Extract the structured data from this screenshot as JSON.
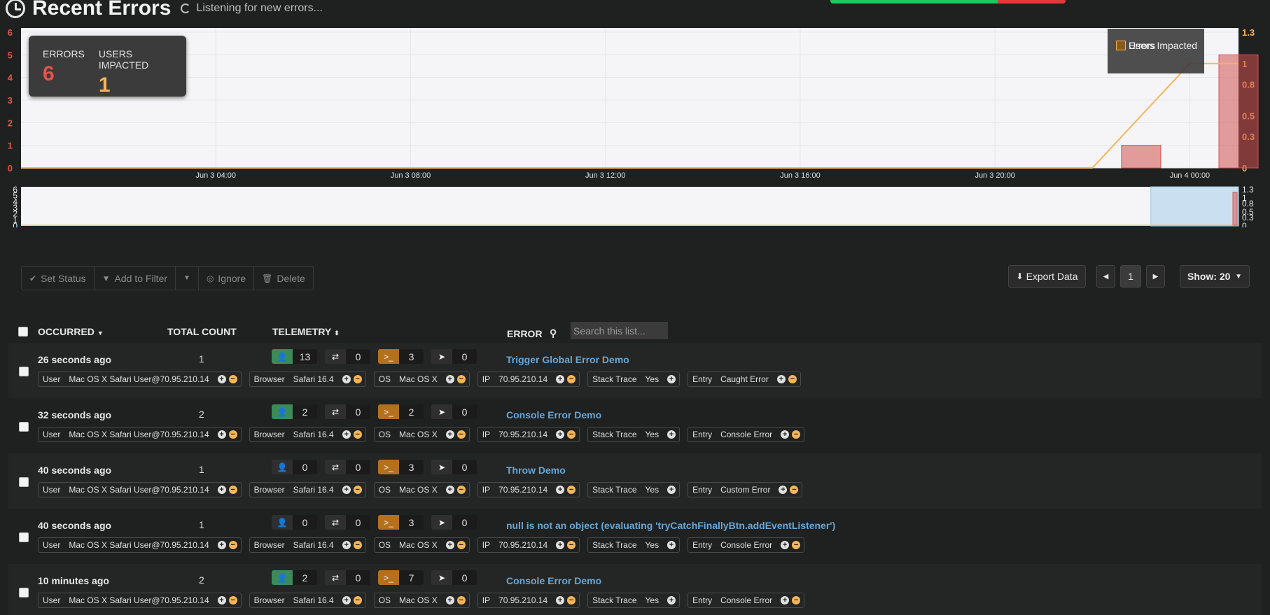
{
  "header": {
    "title": "Recent Errors",
    "status": "Listening for new errors..."
  },
  "stats": {
    "errors_label": "ERRORS",
    "errors_value": "6",
    "users_label": "USERS IMPACTED",
    "users_value": "1"
  },
  "chart_data": [
    {
      "type": "bar",
      "title": "",
      "x_tick_labels": [
        "Jun 3 04:00",
        "Jun 3 08:00",
        "Jun 3 12:00",
        "Jun 3 16:00",
        "Jun 3 20:00",
        "Jun 4 00:00"
      ],
      "y_left_ticks": [
        "0",
        "1",
        "2",
        "3",
        "4",
        "5",
        "6"
      ],
      "y_right_ticks": [
        "0",
        "0.3",
        "0.5",
        "0.8",
        "1",
        "1.3"
      ],
      "ylim_left": [
        0,
        6
      ],
      "ylim_right": [
        0,
        1.3
      ],
      "legend": [
        "Errors",
        "Users Impacted"
      ],
      "legend_position": "top-right",
      "grid": true,
      "series": [
        {
          "name": "Errors",
          "type": "bar",
          "axis": "left",
          "color": "#d9534f",
          "x": [
            "Jun 3 23:00",
            "Jun 4 01:00"
          ],
          "values": [
            1,
            5
          ]
        },
        {
          "name": "Users Impacted",
          "type": "line",
          "axis": "right",
          "color": "#f5b55a",
          "x": [
            "Jun 3 00:00",
            "Jun 3 22:00",
            "Jun 4 00:00",
            "Jun 4 01:00"
          ],
          "values": [
            0,
            0,
            1,
            1
          ]
        }
      ]
    },
    {
      "type": "area",
      "title": "",
      "y_left_ticks": [
        "0",
        "1",
        "2",
        "3",
        "4",
        "5",
        "6"
      ],
      "y_right_ticks": [
        "0",
        "0.3",
        "0.5",
        "0.8",
        "1",
        "1.3"
      ]
    }
  ],
  "toolbar": {
    "set_status": "Set Status",
    "add_to_filter": "Add to Filter",
    "ignore": "Ignore",
    "delete": "Delete",
    "export": "Export Data",
    "page": "1",
    "show": "Show: 20"
  },
  "table": {
    "col_occurred": "OCCURRED",
    "col_total": "TOTAL COUNT",
    "col_telemetry": "TELEMETRY",
    "col_error": "ERROR",
    "search_placeholder": "Search this list...",
    "tag_labels": {
      "user": "User",
      "browser": "Browser",
      "os": "OS",
      "ip": "IP",
      "stack": "Stack Trace",
      "entry": "Entry"
    },
    "rows": [
      {
        "occurred": "26 seconds ago",
        "count": "1",
        "t_user": "13",
        "t_nav": "0",
        "t_console": "3",
        "t_loc": "0",
        "user_active": true,
        "error": "Trigger Global Error Demo",
        "user": "Mac OS X Safari User@70.95.210.14",
        "browser": "Safari 16.4",
        "os": "Mac OS X",
        "ip": "70.95.210.14",
        "stack": "Yes",
        "entry": "Caught Error"
      },
      {
        "occurred": "32 seconds ago",
        "count": "2",
        "t_user": "2",
        "t_nav": "0",
        "t_console": "2",
        "t_loc": "0",
        "user_active": true,
        "error": "Console Error Demo",
        "user": "Mac OS X Safari User@70.95.210.14",
        "browser": "Safari 16.4",
        "os": "Mac OS X",
        "ip": "70.95.210.14",
        "stack": "Yes",
        "entry": "Console Error"
      },
      {
        "occurred": "40 seconds ago",
        "count": "1",
        "t_user": "0",
        "t_nav": "0",
        "t_console": "3",
        "t_loc": "0",
        "user_active": false,
        "error": "Throw Demo",
        "user": "Mac OS X Safari User@70.95.210.14",
        "browser": "Safari 16.4",
        "os": "Mac OS X",
        "ip": "70.95.210.14",
        "stack": "Yes",
        "entry": "Custom Error"
      },
      {
        "occurred": "40 seconds ago",
        "count": "1",
        "t_user": "0",
        "t_nav": "0",
        "t_console": "3",
        "t_loc": "0",
        "user_active": false,
        "error": "null is not an object (evaluating 'tryCatchFinallyBtn.addEventListener')",
        "user": "Mac OS X Safari User@70.95.210.14",
        "browser": "Safari 16.4",
        "os": "Mac OS X",
        "ip": "70.95.210.14",
        "stack": "Yes",
        "entry": "Console Error"
      },
      {
        "occurred": "10 minutes ago",
        "count": "2",
        "t_user": "2",
        "t_nav": "0",
        "t_console": "7",
        "t_loc": "0",
        "user_active": true,
        "error": "Console Error Demo",
        "user": "Mac OS X Safari User@70.95.210.14",
        "browser": "Safari 16.4",
        "os": "Mac OS X",
        "ip": "70.95.210.14",
        "stack": "Yes",
        "entry": "Console Error"
      }
    ]
  }
}
